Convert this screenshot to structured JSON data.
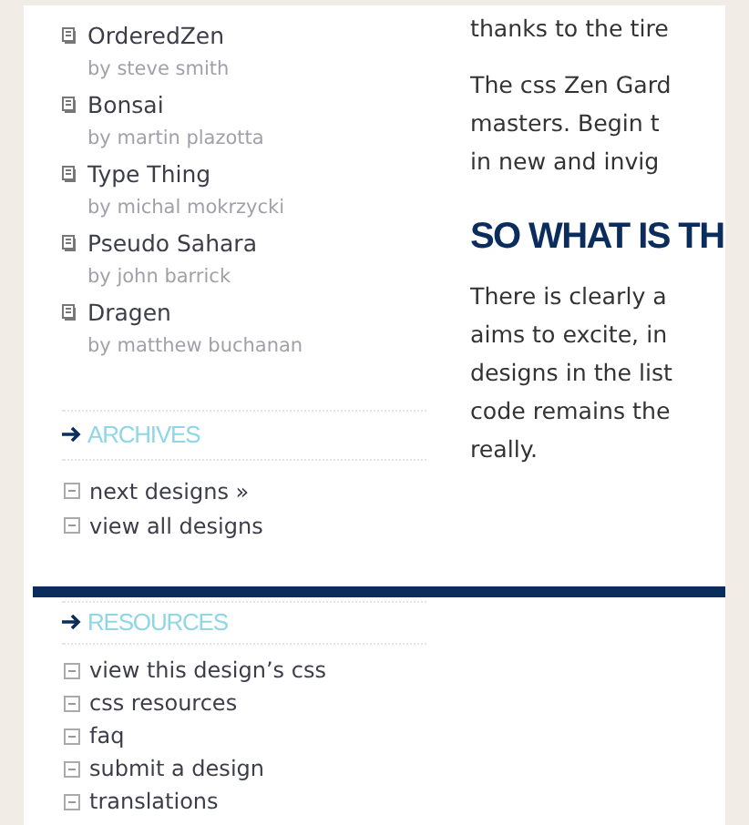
{
  "designs": [
    {
      "title": "OrderedZen",
      "author": "by steve smith"
    },
    {
      "title": "Bonsai",
      "author": "by martin plazotta"
    },
    {
      "title": "Type Thing",
      "author": "by michal mokrzycki"
    },
    {
      "title": "Pseudo Sahara",
      "author": "by john barrick"
    },
    {
      "title": "Dragen",
      "author": "by matthew buchanan"
    }
  ],
  "archives": {
    "heading": "ARCHIVES",
    "links": [
      "next designs »",
      "view all designs"
    ]
  },
  "resources": {
    "heading": "RESOURCES",
    "links": [
      "view this design’s css",
      "css resources",
      "faq",
      "submit a design",
      "translations"
    ]
  },
  "content": [
    {
      "kind": "paragraph",
      "lines": [
        "thanks to the tire"
      ]
    },
    {
      "kind": "paragraph",
      "lines": [
        "The css Zen Gard",
        "masters. Begin t",
        "in new and invig"
      ]
    },
    {
      "kind": "heading",
      "lines": [
        "SO WHAT IS TH"
      ]
    },
    {
      "kind": "paragraph",
      "lines": [
        "There is clearly a",
        "aims to excite, in",
        "designs in the list",
        "code remains the",
        "really."
      ]
    }
  ]
}
